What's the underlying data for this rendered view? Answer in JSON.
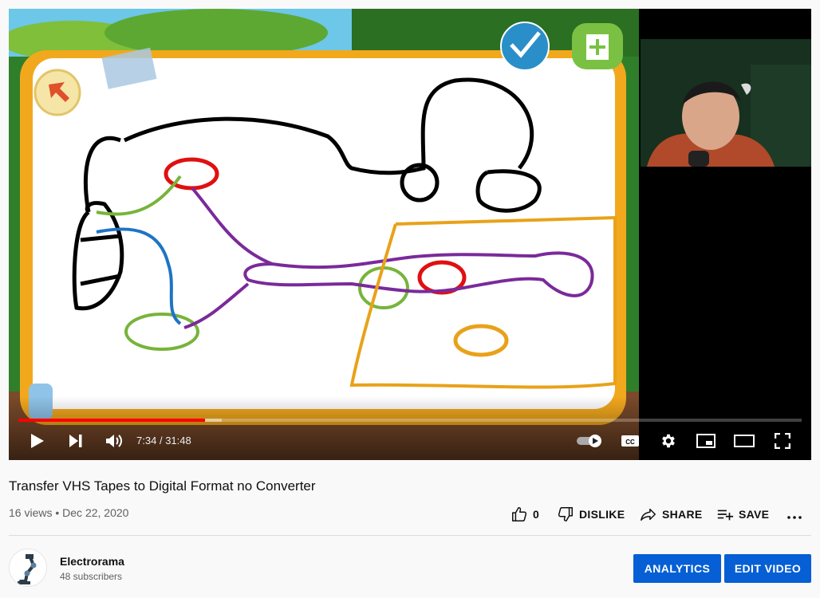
{
  "video": {
    "title": "Transfer VHS Tapes to Digital Format no Converter",
    "views": "16 views",
    "separator": "•",
    "date": "Dec 22, 2020",
    "time_current": "7:34",
    "time_separator": "/",
    "time_total": "31:48",
    "progress_played_fraction": 0.2378,
    "progress_buffered_fraction": 0.26,
    "overlay_finish_label": "Finish"
  },
  "actions": {
    "like_count": "0",
    "dislike_label": "DISLIKE",
    "share_label": "SHARE",
    "save_label": "SAVE"
  },
  "channel": {
    "name": "Electrorama",
    "subscribers": "48 subscribers"
  },
  "buttons": {
    "analytics": "ANALYTICS",
    "edit_video": "EDIT VIDEO"
  },
  "icons": {
    "play": "play-icon",
    "next": "next-icon",
    "volume": "volume-icon",
    "autoplay": "autoplay-toggle-icon",
    "captions": "captions-icon",
    "settings": "gear-icon",
    "miniplayer": "miniplayer-icon",
    "theater": "theater-icon",
    "fullscreen": "fullscreen-icon",
    "like": "thumbs-up-icon",
    "dislike": "thumbs-down-icon",
    "share": "share-icon",
    "save": "playlist-add-icon",
    "more": "more-icon"
  },
  "colors": {
    "progress_played": "#ff0000",
    "primary_button": "#065fd4",
    "board_frame": "#f2a81d",
    "grass": "#3d8a2c"
  }
}
